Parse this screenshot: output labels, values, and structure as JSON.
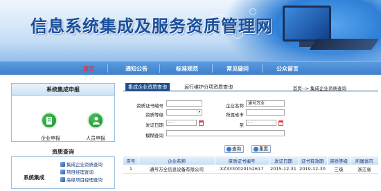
{
  "header": {
    "title": "信息系统集成及服务资质管理网"
  },
  "nav": {
    "items": [
      {
        "label": "首页",
        "active": true
      },
      {
        "label": "通知公告",
        "active": false
      },
      {
        "label": "标准规范",
        "active": false
      },
      {
        "label": "常见疑问",
        "active": false
      },
      {
        "label": "公众留言",
        "active": false
      }
    ]
  },
  "left": {
    "report_title": "系统集成申报",
    "enterprise_label": "企业申报",
    "person_label": "人员申报",
    "query_title": "资质查询",
    "section_label": "系统集成",
    "links": [
      "集成企业资质查询",
      "项目经理查询",
      "高级项目经理查询"
    ]
  },
  "right": {
    "tabs": [
      "集成企业资质查询",
      "运行维护分项资质查询"
    ],
    "breadcrumb": "首页--> 集成企业资质查询",
    "form": {
      "cert_no_label": "资质证书编号",
      "company_label": "企业名称",
      "company_value": "通号万全",
      "level_label": "资质等级",
      "province_label": "所属省市",
      "issue_date_label": "发证日期",
      "date_sep": "至",
      "fuzzy_label": "模糊查询",
      "date_placeholder": "-  -",
      "query_button": "查询",
      "reset_button": "重置"
    },
    "table": {
      "headers": [
        "序号",
        "企业名称",
        "资质证书编号",
        "发证日期",
        "证书有效期",
        "资质等级",
        "所属省市"
      ],
      "rows": [
        [
          "1",
          "通号万全信息设备有限公司",
          "XZ3330020152617",
          "2015-12-31",
          "2019-12-30",
          "三级",
          "浙江省"
        ]
      ]
    }
  },
  "colors": {
    "nav_bg": "#4a8bd4",
    "active_nav": "#ff2a2a",
    "tab_active": "#1f4f8c",
    "title": "#1a4f9c"
  }
}
